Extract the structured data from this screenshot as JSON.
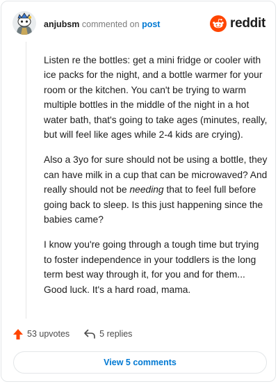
{
  "comment": {
    "username": "anjubsm",
    "verb": "commented on",
    "target_link": "post",
    "paragraphs": [
      [
        "Listen re the bottles: get a mini fridge or cooler with ice packs for the night, and a bottle warmer for your room or the kitchen. You can't be trying to warm multiple bottles in the middle of the night in a hot water bath, that's going to take ages (minutes, really, but will feel like ages while 2-4 kids are crying)."
      ],
      [
        "Also a 3yo for sure should not be using a bottle, they can have milk in a cup that can be microwaved? And really should not be ",
        "needing",
        " that to feel full before going back to sleep. Is this just happening since the babies came?"
      ],
      [
        "I know you're going through a tough time but trying to foster independence in your toddlers is the long term best way through it, for you and for them... Good luck. It's a hard road, mama."
      ]
    ]
  },
  "brand": {
    "name": "reddit",
    "icon": "reddit-logo-icon",
    "color": "#ff4500"
  },
  "actions": {
    "upvotes": "53 upvotes",
    "replies": "5 replies"
  },
  "footer": {
    "view_comments": "View 5 comments"
  },
  "colors": {
    "link": "#0079d3",
    "upvote": "#ff4500"
  }
}
